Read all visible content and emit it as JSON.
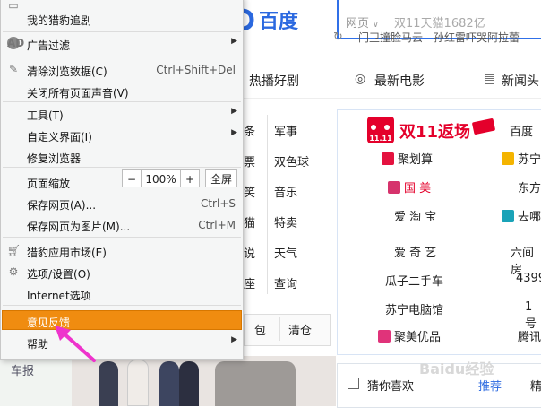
{
  "menu": {
    "top_item": "我的猎豹追剧",
    "ad_filter": "广告过滤",
    "clear_data": "清除浏览数据(C)",
    "clear_data_shortcut": "Ctrl+Shift+Del",
    "mute_all": "关闭所有页面声音(V)",
    "tools": "工具(T)",
    "customize": "自定义界面(I)",
    "repair": "修复浏览器",
    "zoom_label": "页面缩放",
    "zoom_minus": "−",
    "zoom_value": "100%",
    "zoom_plus": "+",
    "fullscreen": "全屏",
    "save_page": "保存网页(A)...",
    "save_page_shortcut": "Ctrl+S",
    "save_as_image": "保存网页为图片(M)...",
    "save_as_image_shortcut": "Ctrl+M",
    "app_market": "猎豹应用市场(E)",
    "options": "选项/设置(O)",
    "internet_options": "Internet选项",
    "feedback": "意见反馈",
    "help": "帮助"
  },
  "page": {
    "logo_text": "百度",
    "search_category": "网页",
    "search_value": "双11天猫1682亿",
    "hot_searches": [
      "门卫撞脸马云",
      "孙红雷吓哭阿拉蕾"
    ],
    "tabs": [
      "热播好剧",
      "最新电影",
      "新闻头"
    ],
    "left_grid": [
      [
        "条",
        "军事"
      ],
      [
        "票",
        "双色球"
      ],
      [
        "笑",
        "音乐"
      ],
      [
        "猫",
        "特卖"
      ],
      [
        "说",
        "天气"
      ],
      [
        "座",
        "查询"
      ]
    ],
    "strip_labels": [
      "包",
      "清仓"
    ],
    "promo_title": "双11返场",
    "promo_badge": "11.11",
    "promo_right_title": "百度",
    "promo_rows": [
      [
        "聚划算",
        "苏宁"
      ],
      [
        "国 美",
        "东方"
      ],
      [
        "爱 淘 宝",
        "去哪"
      ],
      [
        "爱 奇 艺",
        "六间房"
      ],
      [
        "瓜子二手车",
        "4399"
      ],
      [
        "苏宁电脑馆",
        "1 号"
      ],
      [
        "聚美优品",
        "腾讯"
      ]
    ],
    "like_title": "猜你喜欢",
    "like_tab": "推荐",
    "like_tab2": "精",
    "left_bottom_text": "车报",
    "watermark": "Baidu经验"
  },
  "colors": {
    "highlight": "#f08c10",
    "baidu_blue": "#2b69e0",
    "promo_red": "#e4002b",
    "arrow": "#ee33cc"
  }
}
